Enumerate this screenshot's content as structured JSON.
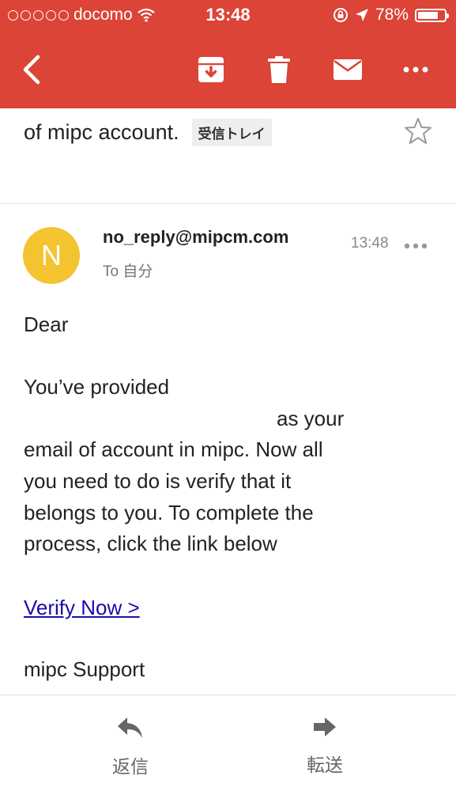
{
  "status_bar": {
    "carrier": "docomo",
    "time": "13:48",
    "battery": "78%",
    "battery_level": 0.78
  },
  "toolbar": {
    "icons": [
      "back-icon",
      "archive-icon",
      "trash-icon",
      "mail-icon",
      "more-icon"
    ]
  },
  "thread": {
    "subject": "of mipc account.",
    "label": "受信トレイ"
  },
  "message": {
    "avatar_letter": "N",
    "avatar_color": "#f4c430",
    "sender": "no_reply@mipcm.com",
    "recipient": "To 自分",
    "time": "13:48",
    "body": {
      "greeting": "Dear",
      "line1": "You’ve provided",
      "line2": "as your",
      "line3": "email of account in mipc. Now all",
      "line4": "you need to do is verify that it",
      "line5": "belongs to you. To complete the",
      "line6": "process, click the link below",
      "link": "Verify Now >",
      "signature": "mipc Support"
    }
  },
  "bottom_actions": {
    "reply": "返信",
    "forward": "転送"
  },
  "colors": {
    "header": "#db4437",
    "link": "#1a0dab"
  }
}
